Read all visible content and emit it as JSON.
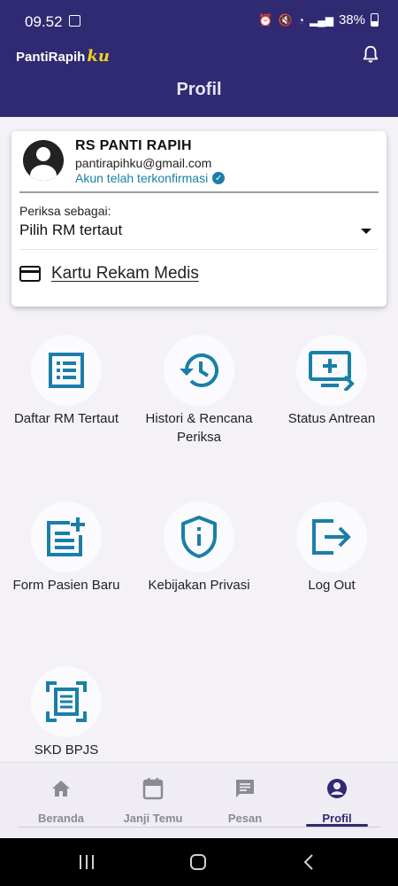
{
  "status_bar": {
    "time": "09.52",
    "battery": "38%"
  },
  "header": {
    "brand_main": "PantiRapih",
    "brand_suffix": "ku",
    "title": "Profil"
  },
  "profile": {
    "name": "RS PANTI RAPIH",
    "email": "pantirapihku@gmail.com",
    "verified_text": "Akun telah terkonfirmasi",
    "check_as_label": "Periksa sebagai:",
    "check_as_value": "Pilih RM tertaut",
    "card_link": "Kartu Rekam Medis"
  },
  "menu": [
    {
      "label": "Daftar RM Tertaut",
      "icon": "list-document-icon"
    },
    {
      "label": "Histori & Rencana Periksa",
      "icon": "history-icon"
    },
    {
      "label": "Status Antrean",
      "icon": "queue-monitor-icon"
    },
    {
      "label": "Form Pasien Baru",
      "icon": "new-form-icon"
    },
    {
      "label": "Kebijakan Privasi",
      "icon": "shield-info-icon"
    },
    {
      "label": "Log Out",
      "icon": "logout-icon"
    },
    {
      "label": "SKD BPJS",
      "icon": "scan-document-icon"
    }
  ],
  "bottom_nav": [
    {
      "label": "Beranda",
      "icon": "home-icon",
      "active": false
    },
    {
      "label": "Janji Temu",
      "icon": "calendar-icon",
      "active": false
    },
    {
      "label": "Pesan",
      "icon": "message-icon",
      "active": false
    },
    {
      "label": "Profil",
      "icon": "account-icon",
      "active": true
    }
  ],
  "colors": {
    "primary": "#2f2a72",
    "accent_icon": "#1a7fa8",
    "brand_suffix": "#f1d21f",
    "background": "#f4f2f7"
  }
}
